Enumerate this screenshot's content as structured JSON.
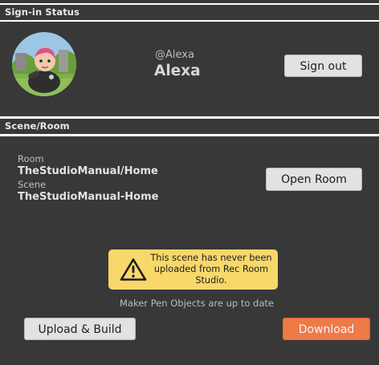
{
  "signin": {
    "header": "Sign-in Status",
    "handle": "@Alexa",
    "name": "Alexa",
    "signout_label": "Sign out"
  },
  "scene_room": {
    "header": "Scene/Room",
    "room_label": "Room",
    "room_value": "TheStudioManual/Home",
    "scene_label": "Scene",
    "scene_value": "TheStudioManual-Home",
    "open_room_label": "Open Room"
  },
  "warning": {
    "icon": "warning-triangle-icon",
    "text": "This scene has never been uploaded from Rec Room Studio.",
    "color": "#f8d86a"
  },
  "status": {
    "maker_pen": "Maker Pen Objects are up to date"
  },
  "actions": {
    "upload_label": "Upload & Build",
    "download_label": "Download",
    "download_color": "#ee7a48"
  },
  "colors": {
    "panel_bg": "#383838",
    "separator": "#ffffff"
  }
}
